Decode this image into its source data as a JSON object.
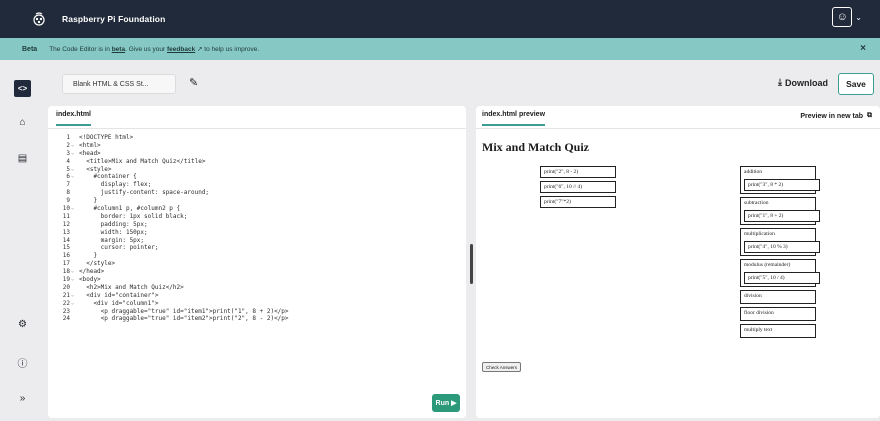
{
  "header": {
    "brand": "Raspberry Pi Foundation",
    "logo_icon": "raspberry-logo-icon",
    "user_icon": "user-avatar-icon"
  },
  "beta_bar": {
    "tag": "Beta",
    "message_prefix": "The Code Editor is in",
    "message_beta": "beta",
    "message_mid": ". Give us your",
    "feedback_link": "feedback",
    "message_suffix": "to help us improve.",
    "close": "×"
  },
  "project": {
    "name": "Blank HTML & CSS St...",
    "download_label": "Download",
    "save_label": "Save"
  },
  "editor": {
    "tab_label": "index.html",
    "run_label": "Run ▶",
    "lines": [
      {
        "n": "1",
        "fold": "",
        "text": "<!DOCTYPE html>"
      },
      {
        "n": "2",
        "fold": "⌄",
        "text": "<html>"
      },
      {
        "n": "3",
        "fold": "⌄",
        "text": "<head>"
      },
      {
        "n": "4",
        "fold": "",
        "text": "  <title>Mix and Match Quiz</title>"
      },
      {
        "n": "5",
        "fold": "⌄",
        "text": "  <style>"
      },
      {
        "n": "6",
        "fold": "⌄",
        "text": "    #container {"
      },
      {
        "n": "7",
        "fold": "",
        "text": "      display: flex;"
      },
      {
        "n": "8",
        "fold": "",
        "text": "      justify-content: space-around;"
      },
      {
        "n": "9",
        "fold": "",
        "text": "    }"
      },
      {
        "n": "10",
        "fold": "⌄",
        "text": "    #column1 p, #column2 p {"
      },
      {
        "n": "11",
        "fold": "",
        "text": "      border: 1px solid black;"
      },
      {
        "n": "12",
        "fold": "",
        "text": "      padding: 5px;"
      },
      {
        "n": "13",
        "fold": "",
        "text": "      width: 150px;"
      },
      {
        "n": "14",
        "fold": "",
        "text": "      margin: 5px;"
      },
      {
        "n": "15",
        "fold": "",
        "text": "      cursor: pointer;"
      },
      {
        "n": "16",
        "fold": "",
        "text": "    }"
      },
      {
        "n": "17",
        "fold": "",
        "text": "  </style>"
      },
      {
        "n": "18",
        "fold": "⌄",
        "text": "</head>"
      },
      {
        "n": "19",
        "fold": "⌄",
        "text": "<body>"
      },
      {
        "n": "20",
        "fold": "",
        "text": "  <h2>Mix and Match Quiz</h2>"
      },
      {
        "n": "21",
        "fold": "⌄",
        "text": "  <div id=\"container\">"
      },
      {
        "n": "22",
        "fold": "⌄",
        "text": "    <div id=\"column1\">"
      },
      {
        "n": "23",
        "fold": "",
        "text": "      <p draggable=\"true\" id=\"item1\">print(\"1\", 8 + 2)</p>"
      },
      {
        "n": "24",
        "fold": "",
        "text": "      <p draggable=\"true\" id=\"item2\">print(\"2\", 8 - 2)</p>"
      }
    ]
  },
  "preview": {
    "tab_label": "index.html preview",
    "new_tab_label": "Preview in new tab",
    "title": "Mix and Match Quiz",
    "column1": [
      "print(\"2\", 8 - 2)",
      "print(\"6\", 10 // 4)",
      "print(\"7\"*2)"
    ],
    "column2": [
      {
        "label": "addition",
        "item": "print(\"3\", 8 * 2)"
      },
      {
        "label": "subtraction",
        "item": "print(\"1\", 8 + 2)"
      },
      {
        "label": "multiplication",
        "item": "print(\"4\", 10 % 3)"
      },
      {
        "label": "modulus (remainder)",
        "item": "print(\"5\", 10 / 4)"
      },
      {
        "label": "division",
        "item": ""
      },
      {
        "label": "floor division",
        "item": ""
      },
      {
        "label": "multiply text",
        "item": ""
      }
    ],
    "check_label": "Check Answers"
  },
  "colors": {
    "header_bg": "#212a3a",
    "beta_bg": "#86c8c4",
    "accent": "#3e9c97",
    "run_bg": "#2c9a7a"
  }
}
